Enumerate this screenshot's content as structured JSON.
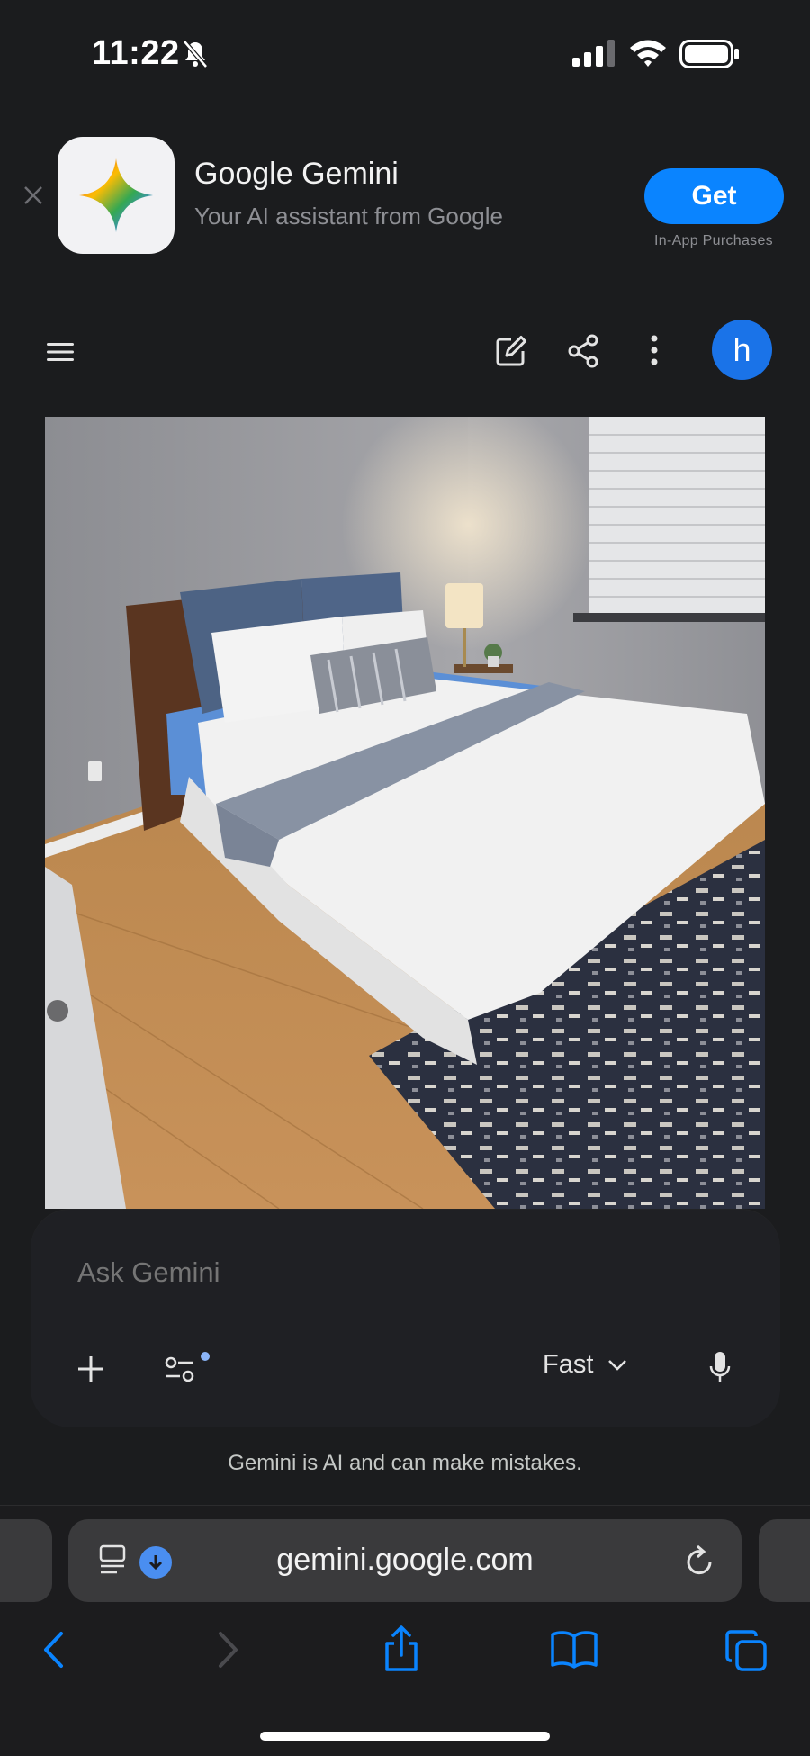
{
  "status_bar": {
    "time": "11:22",
    "icons": [
      "bell-slash-icon",
      "cellular-signal-icon",
      "wifi-icon",
      "battery-icon"
    ]
  },
  "app_banner": {
    "app_name": "Google Gemini",
    "subtitle": "Your AI assistant from Google",
    "get_label": "Get",
    "in_app_purchases": "In-App Purchases",
    "accent": "#0a84ff"
  },
  "toolbar": {
    "icons": [
      "menu-icon",
      "edit-icon",
      "share-icon",
      "more-icon"
    ],
    "avatar_letter": "h",
    "avatar_color": "#1a73e8"
  },
  "prompt": {
    "placeholder": "Ask Gemini",
    "mode": "Fast"
  },
  "disclaimer": "Gemini is AI and can make mistakes.",
  "browser": {
    "url": "gemini.google.com"
  }
}
